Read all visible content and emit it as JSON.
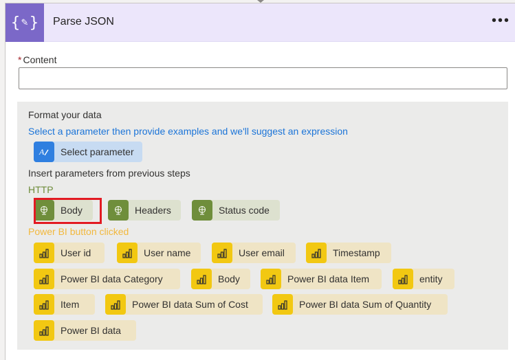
{
  "action": {
    "title": "Parse JSON",
    "more_label": "•••",
    "icon": "parse-json-icon",
    "accent": "#7b68c8"
  },
  "content": {
    "required_mark": "*",
    "label": "Content",
    "value": ""
  },
  "panel": {
    "format_title": "Format your data",
    "select_hint": "Select a parameter then provide examples and we'll suggest an expression",
    "select_button": "Select parameter",
    "insert_title": "Insert parameters from previous steps"
  },
  "groups": {
    "http": {
      "title": "HTTP",
      "color": "#6e8c3a",
      "items": [
        "Body",
        "Headers",
        "Status code"
      ]
    },
    "powerbi": {
      "title": "Power BI button clicked",
      "color": "#f2b83d",
      "items": [
        "User id",
        "User name",
        "User email",
        "Timestamp",
        "Power BI data Category",
        "Body",
        "Power BI data Item",
        "entity",
        "Item",
        "Power BI data Sum of Cost",
        "Power BI data Sum of Quantity",
        "Power BI data"
      ]
    }
  },
  "highlight": {
    "target": "Body",
    "color": "#e21a23"
  }
}
